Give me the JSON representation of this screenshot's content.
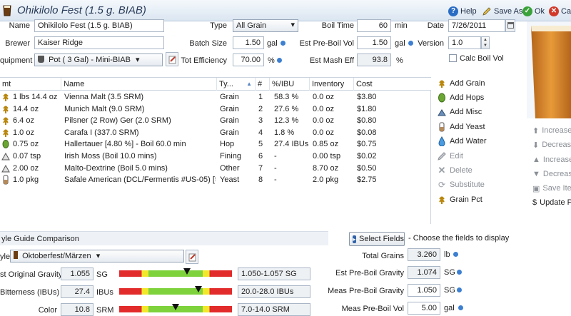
{
  "window": {
    "title": "Ohikilolo Fest (1.5 g. BIAB)",
    "help_label": "Help",
    "save_as_label": "Save As",
    "ok_label": "Ok",
    "cancel_label": "Car"
  },
  "recipe": {
    "name_label": "Name",
    "name_value": "Ohikilolo Fest (1.5 g. BIAB)",
    "type_label": "Type",
    "type_value": "All Grain",
    "boil_time_label": "Boil Time",
    "boil_time_value": "60",
    "boil_time_unit": "min",
    "date_label": "Date",
    "date_value": "7/26/2011",
    "brewer_label": "Brewer",
    "brewer_value": "Kaiser Ridge",
    "batch_size_label": "Batch Size",
    "batch_size_value": "1.50",
    "batch_size_unit": "gal",
    "pre_boil_vol_label": "Est Pre-Boil Vol",
    "pre_boil_vol_value": "1.50",
    "pre_boil_vol_unit": "gal",
    "version_label": "Version",
    "version_value": "1.0",
    "equipment_label": "quipment",
    "equipment_value": "Pot ( 3 Gal) - Mini-BIAB",
    "efficiency_label": "Tot Efficiency",
    "efficiency_value": "70.00",
    "efficiency_unit": "%",
    "mash_eff_label": "Est Mash Eff",
    "mash_eff_value": "93.8",
    "mash_eff_unit": "%",
    "calc_boil_vol_label": "Calc Boil Vol"
  },
  "ingredients": {
    "headers": {
      "amt": "mt",
      "name": "Name",
      "type": "Ty...",
      "num": "#",
      "ibu": "%/IBU",
      "inventory": "Inventory",
      "cost": "Cost"
    },
    "rows": [
      {
        "amt": "1 lbs 14.4 oz",
        "name": "Vienna Malt (3.5 SRM)",
        "type": "Grain",
        "num": "1",
        "ibu": "58.3 %",
        "inventory": "0.0 oz",
        "cost": "$3.80",
        "icon": "grain-icon"
      },
      {
        "amt": "14.4 oz",
        "name": "Munich Malt (9.0 SRM)",
        "type": "Grain",
        "num": "2",
        "ibu": "27.6 %",
        "inventory": "0.0 oz",
        "cost": "$1.80",
        "icon": "grain-icon"
      },
      {
        "amt": "6.4 oz",
        "name": "Pilsner (2 Row) Ger (2.0 SRM)",
        "type": "Grain",
        "num": "3",
        "ibu": "12.3 %",
        "inventory": "0.0 oz",
        "cost": "$0.80",
        "icon": "grain-icon"
      },
      {
        "amt": "1.0 oz",
        "name": "Carafa I (337.0 SRM)",
        "type": "Grain",
        "num": "4",
        "ibu": "1.8 %",
        "inventory": "0.0 oz",
        "cost": "$0.08",
        "icon": "grain-icon"
      },
      {
        "amt": "0.75 oz",
        "name": "Hallertauer [4.80 %] - Boil 60.0 min",
        "type": "Hop",
        "num": "5",
        "ibu": "27.4 IBUs",
        "inventory": "0.85 oz",
        "cost": "$0.75",
        "icon": "hop-icon"
      },
      {
        "amt": "0.07 tsp",
        "name": "Irish Moss (Boil 10.0 mins)",
        "type": "Fining",
        "num": "6",
        "ibu": "-",
        "inventory": "0.00 tsp",
        "cost": "$0.02",
        "icon": "misc-icon"
      },
      {
        "amt": "2.00 oz",
        "name": "Malto-Dextrine (Boil 5.0 mins)",
        "type": "Other",
        "num": "7",
        "ibu": "-",
        "inventory": "8.70 oz",
        "cost": "$0.50",
        "icon": "misc-icon"
      },
      {
        "amt": "1.0 pkg",
        "name": "Safale American  (DCL/Fermentis #US-05) [5...",
        "type": "Yeast",
        "num": "8",
        "ibu": "-",
        "inventory": "2.0 pkg",
        "cost": "$2.75",
        "icon": "yeast-icon"
      }
    ]
  },
  "actions": {
    "add_grain": "Add Grain",
    "add_hops": "Add Hops",
    "add_misc": "Add Misc",
    "add_yeast": "Add Yeast",
    "add_water": "Add Water",
    "edit": "Edit",
    "delete": "Delete",
    "substitute": "Substitute",
    "grain_pct": "Grain Pct"
  },
  "side": {
    "increase1": "Increase",
    "decrease1": "Decrease",
    "increase2": "Increase",
    "decrease2": "Decrease",
    "save_item": "Save Iten",
    "update": "Update P"
  },
  "style_guide": {
    "section_title": "yle Guide Comparison",
    "style_label": "yle",
    "style_value": "Oktoberfest/Märzen",
    "og_label": "st Original Gravity",
    "og_value": "1.055",
    "og_unit": "SG",
    "og_range": "1.050-1.057 SG",
    "og_level": 0.6,
    "ibu_label": "Bitterness (IBUs)",
    "ibu_value": "27.4",
    "ibu_unit": "IBUs",
    "ibu_range": "20.0-28.0 IBUs",
    "ibu_level": 0.7,
    "color_label": "Color",
    "color_value": "10.8",
    "color_unit": "SRM",
    "color_range": "7.0-14.0 SRM",
    "color_level": 0.5
  },
  "stats": {
    "select_fields_label": "Select Fields",
    "select_fields_hint": "- Choose the fields to display",
    "total_grains_label": "Total Grains",
    "total_grains_value": "3.260",
    "total_grains_unit": "lb",
    "pre_boil_grav_label": "Est Pre-Boil Gravity",
    "pre_boil_grav_value": "1.074",
    "pre_boil_grav_unit": "SG",
    "meas_pre_boil_grav_label": "Meas Pre-Boil Gravity",
    "meas_pre_boil_grav_value": "1.050",
    "meas_pre_boil_grav_unit": "SG",
    "meas_pre_boil_vol_label": "Meas Pre-Boil Vol",
    "meas_pre_boil_vol_value": "5.00",
    "meas_pre_boil_vol_unit": "gal"
  },
  "colors": {
    "accent": "#3d7fd1",
    "grain": "#b8860b",
    "hop": "#5a8f2a",
    "green_bar": "#7ed23c",
    "red_bar": "#e22b2b",
    "yellow_bar": "#f2e82b"
  }
}
